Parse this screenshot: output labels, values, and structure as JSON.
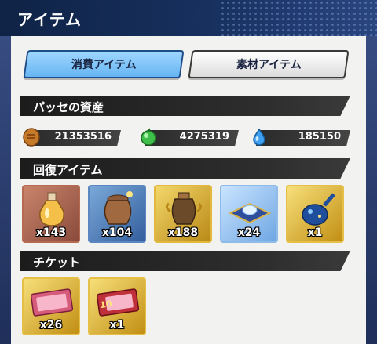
{
  "header": {
    "title": "アイテム"
  },
  "tabs": [
    {
      "label": "消費アイテム",
      "active": true
    },
    {
      "label": "素材アイテム",
      "active": false
    }
  ],
  "sections": {
    "assets": "パッセの資産",
    "recovery": "回復アイテム",
    "tickets": "チケット"
  },
  "assets": [
    {
      "icon": "coin-icon",
      "value": "21353516"
    },
    {
      "icon": "green-gem-icon",
      "value": "4275319"
    },
    {
      "icon": "blue-drop-icon",
      "value": "185150"
    }
  ],
  "recovery_items": [
    {
      "icon": "potion-bottle-icon",
      "count": "x143"
    },
    {
      "icon": "pot-icon",
      "count": "x104"
    },
    {
      "icon": "golden-urn-icon",
      "count": "x188"
    },
    {
      "icon": "crystal-cushion-icon",
      "count": "x24"
    },
    {
      "icon": "blue-vase-icon",
      "count": "x1"
    }
  ],
  "ticket_items": [
    {
      "icon": "pink-ticket-icon",
      "count": "x26"
    },
    {
      "icon": "ten-ticket-icon",
      "count": "x1"
    }
  ]
}
